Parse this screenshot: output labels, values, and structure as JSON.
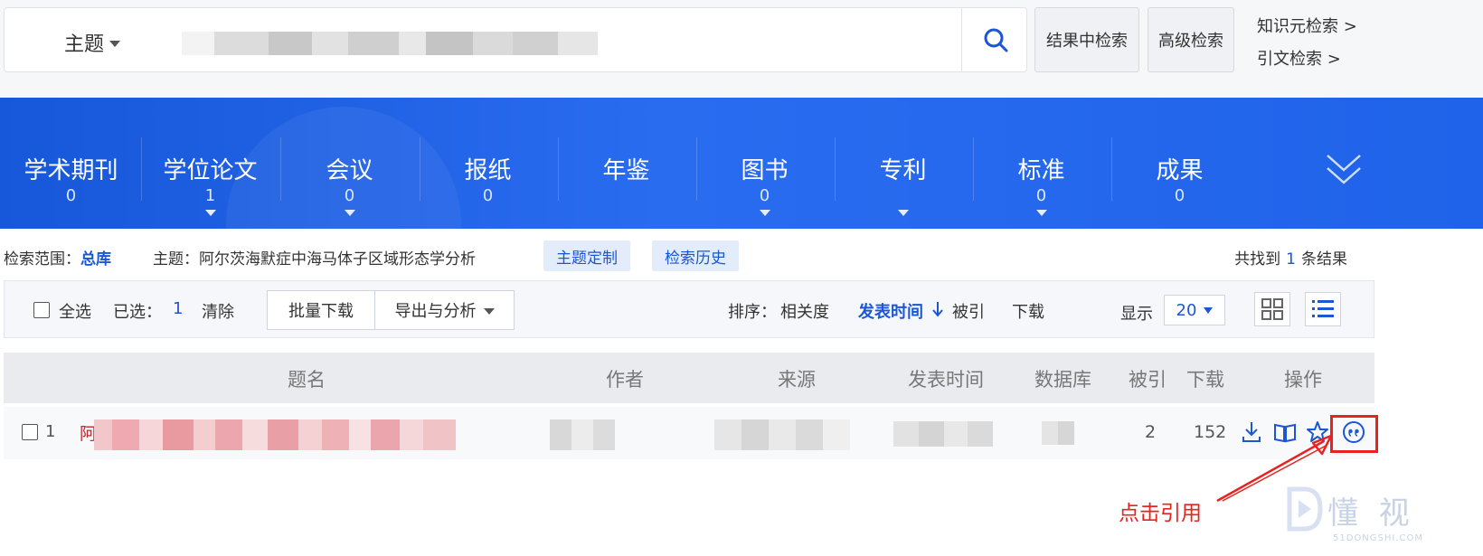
{
  "search": {
    "field_label": "主题",
    "query": "",
    "advanced_in_results": "结果中检索",
    "advanced_search": "高级检索",
    "side_links": [
      "知识元检索 >",
      "引文检索 >"
    ]
  },
  "categories": [
    {
      "label": "学术期刊",
      "count": "0",
      "has_dropdown": false
    },
    {
      "label": "学位论文",
      "count": "1",
      "has_dropdown": true
    },
    {
      "label": "会议",
      "count": "0",
      "has_dropdown": true
    },
    {
      "label": "报纸",
      "count": "0",
      "has_dropdown": false
    },
    {
      "label": "年鉴",
      "count": "",
      "has_dropdown": false
    },
    {
      "label": "图书",
      "count": "0",
      "has_dropdown": true
    },
    {
      "label": "专利",
      "count": "",
      "has_dropdown": true
    },
    {
      "label": "标准",
      "count": "0",
      "has_dropdown": true
    },
    {
      "label": "成果",
      "count": "0",
      "has_dropdown": false
    }
  ],
  "scope": {
    "range_label": "检索范围：",
    "range_value": "总库",
    "topic_label": "主题：",
    "topic_value": "阿尔茨海默症中海马体子区域形态学分析",
    "topic_custom": "主题定制",
    "search_history": "检索历史",
    "result_prefix": "共找到",
    "result_count": "1",
    "result_suffix": "条结果"
  },
  "toolbar": {
    "select_all": "全选",
    "selected_label": "已选：",
    "selected_count": "1",
    "clear": "清除",
    "batch_download": "批量下载",
    "export_analysis": "导出与分析",
    "sort_label": "排序：",
    "sort_relevance": "相关度",
    "sort_pubtime": "发表时间",
    "sort_cited": "被引",
    "sort_download": "下载",
    "display_label": "显示",
    "display_value": "20"
  },
  "table": {
    "headers": {
      "title": "题名",
      "author": "作者",
      "source": "来源",
      "pubtime": "发表时间",
      "database": "数据库",
      "cited": "被引",
      "downloads": "下载",
      "actions": "操作"
    },
    "rows": [
      {
        "index": "1",
        "title_visible": "阿",
        "cited": "2",
        "downloads": "152"
      }
    ]
  },
  "annotation": {
    "text": "点击引用"
  },
  "watermark": {
    "text": "懂 视",
    "sub": "51DONGSHI.COM"
  },
  "colors": {
    "brand_blue": "#1f63ea",
    "link_blue": "#1a56d6",
    "annotation_red": "#e8231f"
  }
}
